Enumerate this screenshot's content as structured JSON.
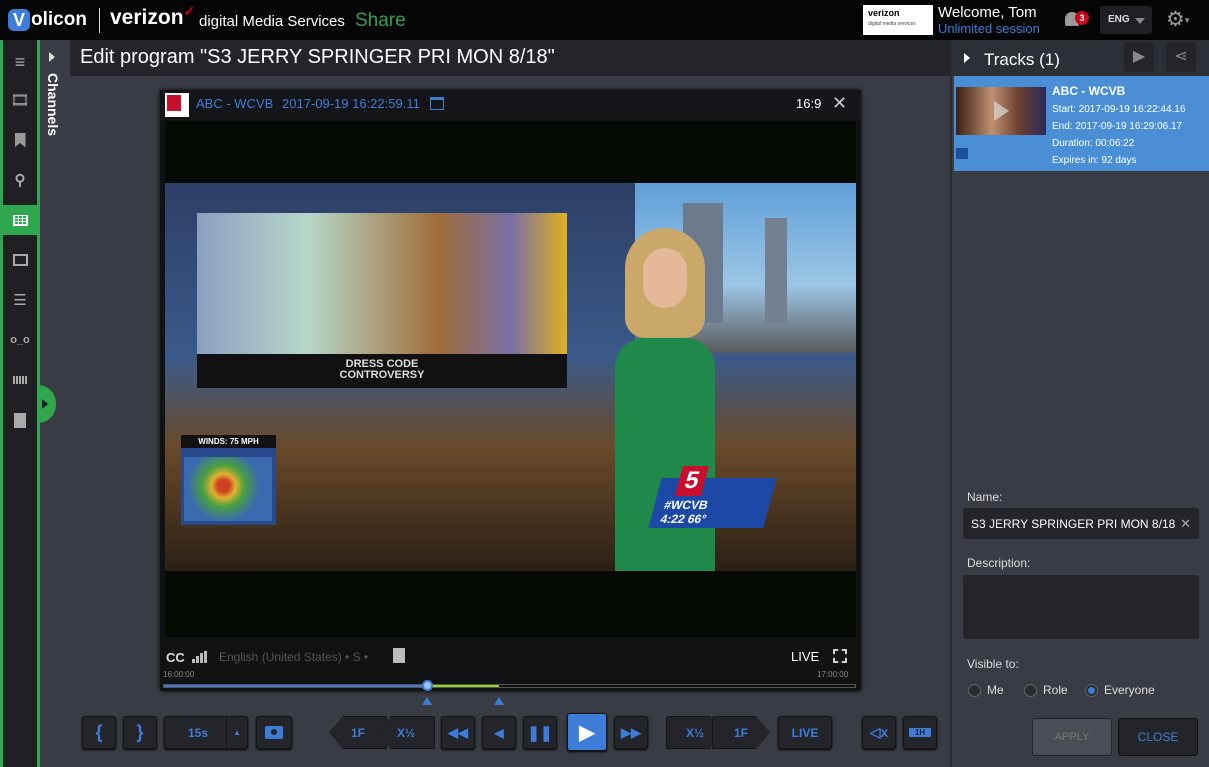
{
  "header": {
    "logo": "Volicon",
    "logo_letter": "V",
    "logo_rest": "olicon",
    "brand": "verizon",
    "brand_check": "✓",
    "brand_subtitle": "digital Media Services",
    "app_name": "Share",
    "badge_title": "verizon",
    "badge_subtitle": "digital media services",
    "welcome": "Welcome, Tom",
    "session": "Unlimited session",
    "notifications_count": "3",
    "language": "ENG"
  },
  "nav": {
    "items": [
      {
        "name": "menu",
        "icon": "≡"
      },
      {
        "name": "film",
        "icon": "▦"
      },
      {
        "name": "bookmark",
        "icon": "▮"
      },
      {
        "name": "search",
        "icon": "⚲"
      },
      {
        "name": "table",
        "icon": "▦"
      },
      {
        "name": "monitor",
        "icon": "▣"
      },
      {
        "name": "list",
        "icon": "☰"
      },
      {
        "name": "voicemail",
        "icon": "oo"
      },
      {
        "name": "grid",
        "icon": "⁞⁞⁞"
      },
      {
        "name": "export",
        "icon": "▤"
      }
    ],
    "active": "table"
  },
  "channels_panel": {
    "label": "Channels"
  },
  "page": {
    "title": "Edit program \"S3 JERRY SPRINGER PRI MON 8/18\""
  },
  "player": {
    "channel": "ABC - WCVB",
    "timestamp": "2017-09-19 16:22:59.11",
    "aspect_ratio": "16:9",
    "close": "✕",
    "video": {
      "board_caption_line1": "DRESS CODE",
      "board_caption_line2": "CONTROVERSY",
      "weather_label": "WINDS: 75 MPH",
      "station_logo": "5",
      "station_tag": "#WCVB",
      "station_time": "4:22  66°"
    },
    "cc": "CC",
    "caption_language": "English (United States)  • S •",
    "live_label": "LIVE",
    "timeline_start": "16:00:00",
    "timeline_end": "17:00:00",
    "played_fraction": 0.38,
    "clip_start_fraction": 0.38,
    "clip_end_fraction": 0.485
  },
  "controls": {
    "mark_in": "{",
    "mark_out": "}",
    "skip_interval": "15s",
    "frame_back": "1F",
    "slow_back": "X½",
    "frame_fwd": "1F",
    "slow_fwd": "X½",
    "live": "LIVE",
    "zoom_level": "1H"
  },
  "tracks": {
    "title": "Tracks (1)",
    "items": [
      {
        "channel": "ABC - WCVB",
        "start": "Start: 2017-09-19 16:22:44.16",
        "end": "End: 2017-09-19 16:29:06.17",
        "duration": "Duration: 00:06:22",
        "expires": "Expires in: 92 days"
      }
    ]
  },
  "form": {
    "name_label": "Name:",
    "name_value": "S3 JERRY SPRINGER PRI MON 8/18",
    "description_label": "Description:",
    "description_value": "",
    "visible_label": "Visible to:",
    "visibility_options": [
      "Me",
      "Role",
      "Everyone"
    ],
    "visibility_selected": "Everyone",
    "apply": "APPLY",
    "close": "CLOSE"
  },
  "colors": {
    "accent_blue": "#3d7dd8",
    "accent_green": "#2ea74f",
    "clip_green": "#8fd61e",
    "alert_red": "#d0021b"
  }
}
